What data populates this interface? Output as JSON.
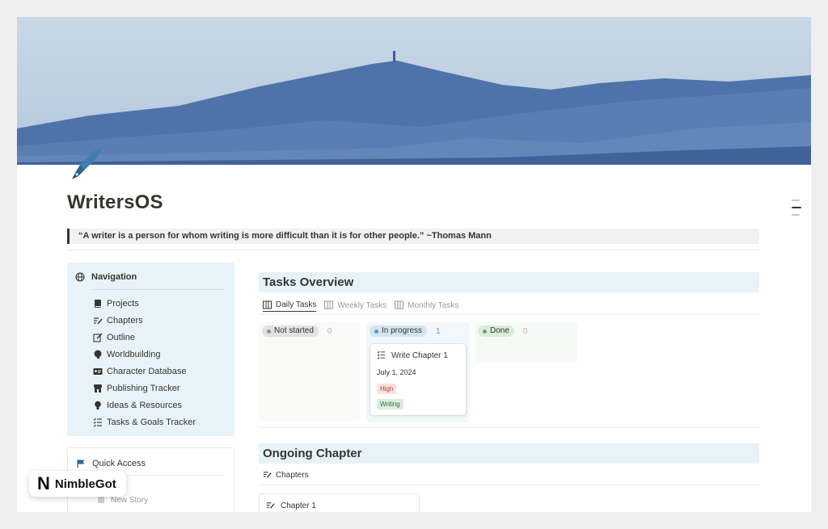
{
  "page": {
    "title": "WritersOS",
    "quote": "“A writer is a person for whom writing is more difficult than it is for other people.” ~Thomas Mann",
    "page_icon": "fountain-pen-icon"
  },
  "navigation": {
    "heading": "Navigation",
    "icon": "globe-icon",
    "items": [
      {
        "label": "Projects",
        "icon": "book-icon"
      },
      {
        "label": "Chapters",
        "icon": "list-pen-icon"
      },
      {
        "label": "Outline",
        "icon": "edit-icon"
      },
      {
        "label": "Worldbuilding",
        "icon": "brain-icon"
      },
      {
        "label": "Character Database",
        "icon": "id-card-icon"
      },
      {
        "label": "Publishing Tracker",
        "icon": "store-icon"
      },
      {
        "label": "Ideas & Resources",
        "icon": "lightbulb-icon"
      },
      {
        "label": "Tasks & Goals Tracker",
        "icon": "checklist-icon"
      }
    ]
  },
  "quick_access": {
    "heading": "Quick Access",
    "icon": "flag-icon",
    "items": [
      {
        "label": "New Story",
        "icon": "page-icon"
      }
    ]
  },
  "tasks": {
    "heading": "Tasks Overview",
    "tabs": [
      {
        "label": "Daily Tasks",
        "active": true
      },
      {
        "label": "Weekly Tasks",
        "active": false
      },
      {
        "label": "Monthly Tasks",
        "active": false
      }
    ],
    "columns": [
      {
        "status": "Not started",
        "count": "0",
        "color": "#91918e"
      },
      {
        "status": "In progress",
        "count": "1",
        "color": "#5b97bd"
      },
      {
        "status": "Done",
        "count": "0",
        "color": "#6c9b7d"
      }
    ],
    "card": {
      "title": "Write Chapter 1",
      "date": "July 1, 2024",
      "priority": "High",
      "category": "Writing"
    }
  },
  "chapter": {
    "heading": "Ongoing Chapter",
    "view_label": "Chapters",
    "card_title": "Chapter 1"
  },
  "watermark": {
    "logo": "N",
    "text": "NimbleGot"
  },
  "colors": {
    "callout_bg": "#e7f3f8",
    "in_progress_bg": "#d3e5ef",
    "done_bg": "#dbeddb",
    "not_started_bg": "#e3e2e0",
    "high_tag_bg": "#ffe2dd",
    "writing_tag_bg": "#dbeddb"
  }
}
